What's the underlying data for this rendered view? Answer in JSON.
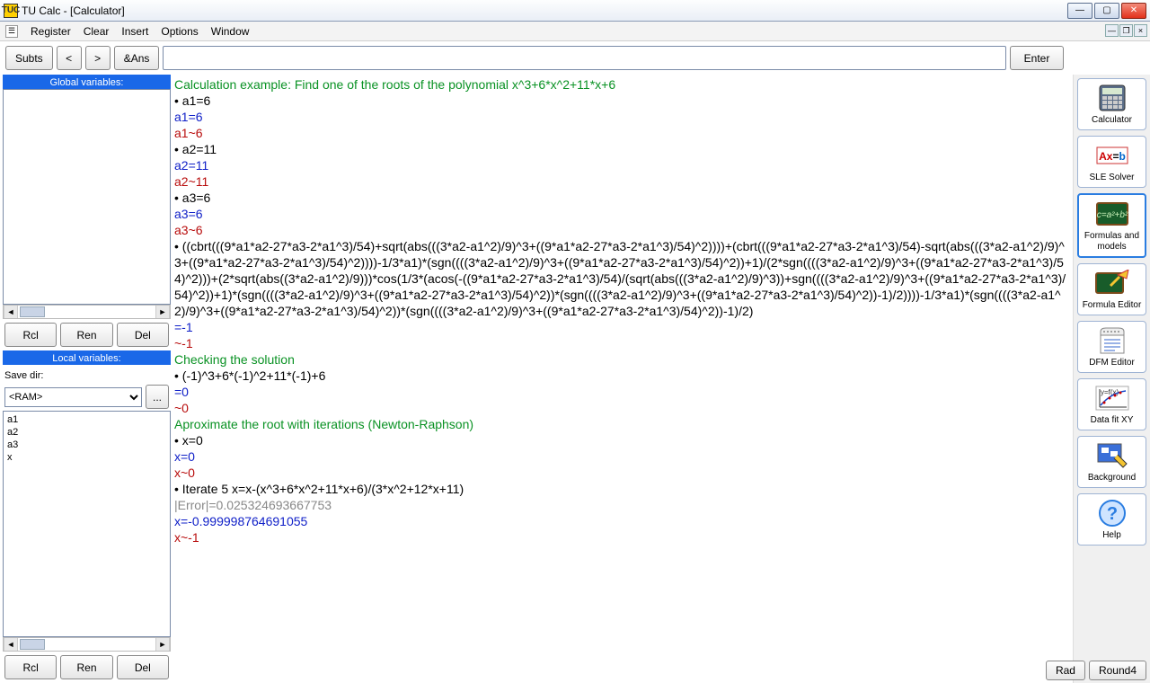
{
  "window": {
    "title": "TU Calc - [Calculator]",
    "icon_text": "TUC"
  },
  "menu": {
    "register": "Register",
    "clear": "Clear",
    "insert": "Insert",
    "options": "Options",
    "window": "Window"
  },
  "toolbar": {
    "subts": "Subts",
    "prev": "<",
    "next": ">",
    "ans": "&Ans",
    "enter": "Enter",
    "input_value": ""
  },
  "sidebar": {
    "global_header": "Global variables:",
    "rcl": "Rcl",
    "ren": "Ren",
    "del": "Del",
    "local_header": "Local variables:",
    "save_dir_label": "Save dir:",
    "save_dir_value": "<RAM>",
    "browse": "...",
    "locals": [
      "a1",
      "a2",
      "a3",
      "x"
    ]
  },
  "content": {
    "l1": "Calculation example: Find one of the roots of the polynomial x^3+6*x^2+11*x+6",
    "l2": "• a1=6",
    "l3": "a1=6",
    "l4": "a1~6",
    "l5": "• a2=11",
    "l6": "a2=11",
    "l7": "a2~11",
    "l8": "• a3=6",
    "l9": "a3=6",
    "l10": "a3~6",
    "l11": "• ((cbrt(((9*a1*a2-27*a3-2*a1^3)/54)+sqrt(abs(((3*a2-a1^2)/9)^3+((9*a1*a2-27*a3-2*a1^3)/54)^2))))+(cbrt(((9*a1*a2-27*a3-2*a1^3)/54)-sqrt(abs(((3*a2-a1^2)/9)^3+((9*a1*a2-27*a3-2*a1^3)/54)^2))))-1/3*a1)*(sgn((((3*a2-a1^2)/9)^3+((9*a1*a2-27*a3-2*a1^3)/54)^2))+1)/(2*sgn((((3*a2-a1^2)/9)^3+((9*a1*a2-27*a3-2*a1^3)/54)^2)))+(2*sqrt(abs((3*a2-a1^2)/9)))*cos(1/3*(acos(-((9*a1*a2-27*a3-2*a1^3)/54)/(sqrt(abs(((3*a2-a1^2)/9)^3))+sgn((((3*a2-a1^2)/9)^3+((9*a1*a2-27*a3-2*a1^3)/54)^2))+1)*(sgn((((3*a2-a1^2)/9)^3+((9*a1*a2-27*a3-2*a1^3)/54)^2))*(sgn((((3*a2-a1^2)/9)^3+((9*a1*a2-27*a3-2*a1^3)/54)^2))-1)/2))))-1/3*a1)*(sgn((((3*a2-a1^2)/9)^3+((9*a1*a2-27*a3-2*a1^3)/54)^2))*(sgn((((3*a2-a1^2)/9)^3+((9*a1*a2-27*a3-2*a1^3)/54)^2))-1)/2)",
    "l12": "=-1",
    "l13": "~-1",
    "l14": "Checking the solution",
    "l15": "• (-1)^3+6*(-1)^2+11*(-1)+6",
    "l16": "=0",
    "l17": "~0",
    "l18": "Aproximate the root with iterations (Newton-Raphson)",
    "l19": "• x=0",
    "l20": "x=0",
    "l21": "x~0",
    "l22": "• Iterate 5 x=x-(x^3+6*x^2+11*x+6)/(3*x^2+12*x+11)",
    "l23": "|Error|=0.025324693667753",
    "l24": "x=-0.999998764691055",
    "l25": "x~-1"
  },
  "tools": {
    "calculator": "Calculator",
    "sle": "SLE Solver",
    "formulas": "Formulas and models",
    "feditor": "Formula Editor",
    "dfm": "DFM Editor",
    "datafit": "Data fit XY",
    "background": "Background",
    "help": "Help"
  },
  "status": {
    "rad": "Rad",
    "round": "Round4"
  }
}
